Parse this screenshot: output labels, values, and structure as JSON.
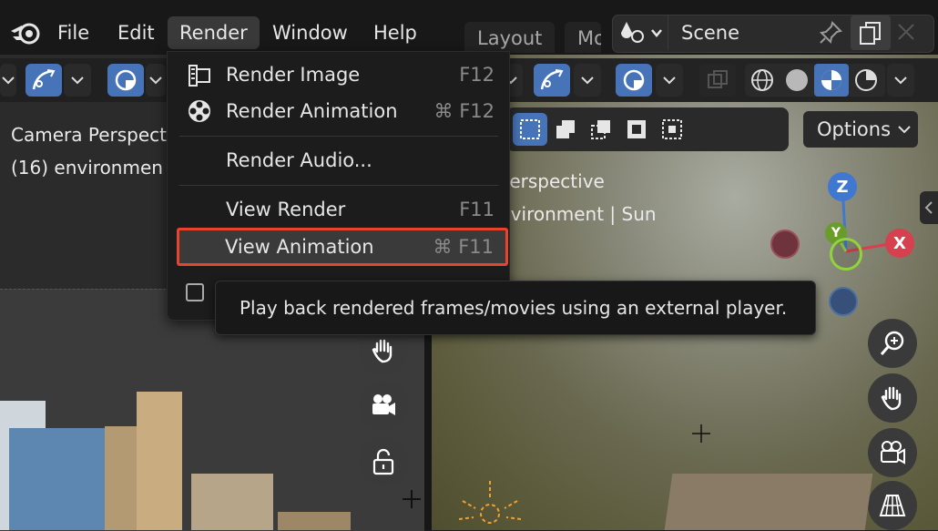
{
  "menubar": {
    "items": [
      {
        "label": "File"
      },
      {
        "label": "Edit"
      },
      {
        "label": "Render"
      },
      {
        "label": "Window"
      },
      {
        "label": "Help"
      }
    ],
    "tabs": [
      {
        "label": "Layout"
      },
      {
        "label": "Mo"
      }
    ],
    "scene_name": "Scene"
  },
  "left_viewport": {
    "overlay_line1": "Camera Perspect",
    "overlay_line2": "(16) environmen"
  },
  "right_viewport": {
    "overlay_line1": "Perspective",
    "overlay_line2": "nvironment | Sun",
    "options_label": "Options",
    "gizmo": {
      "z": "Z",
      "y": "Y",
      "x": "X"
    }
  },
  "render_menu": {
    "items": [
      {
        "label": "Render Image",
        "shortcut": "F12",
        "icon": "render-image-icon"
      },
      {
        "label": "Render Animation",
        "shortcut": "⌘ F12",
        "icon": "render-animation-icon"
      },
      {
        "label": "Render Audio...",
        "shortcut": ""
      },
      {
        "label": "View Render",
        "shortcut": "F11"
      },
      {
        "label": "View Animation",
        "shortcut": "⌘ F11"
      }
    ]
  },
  "tooltip": {
    "text": "Play back rendered frames/movies using an external player."
  },
  "colors": {
    "accent_blue": "#4773b8",
    "highlight_red": "#e8432d",
    "axis_x": "#d6404f",
    "axis_y": "#8fd43b",
    "axis_z": "#3f78d1"
  }
}
